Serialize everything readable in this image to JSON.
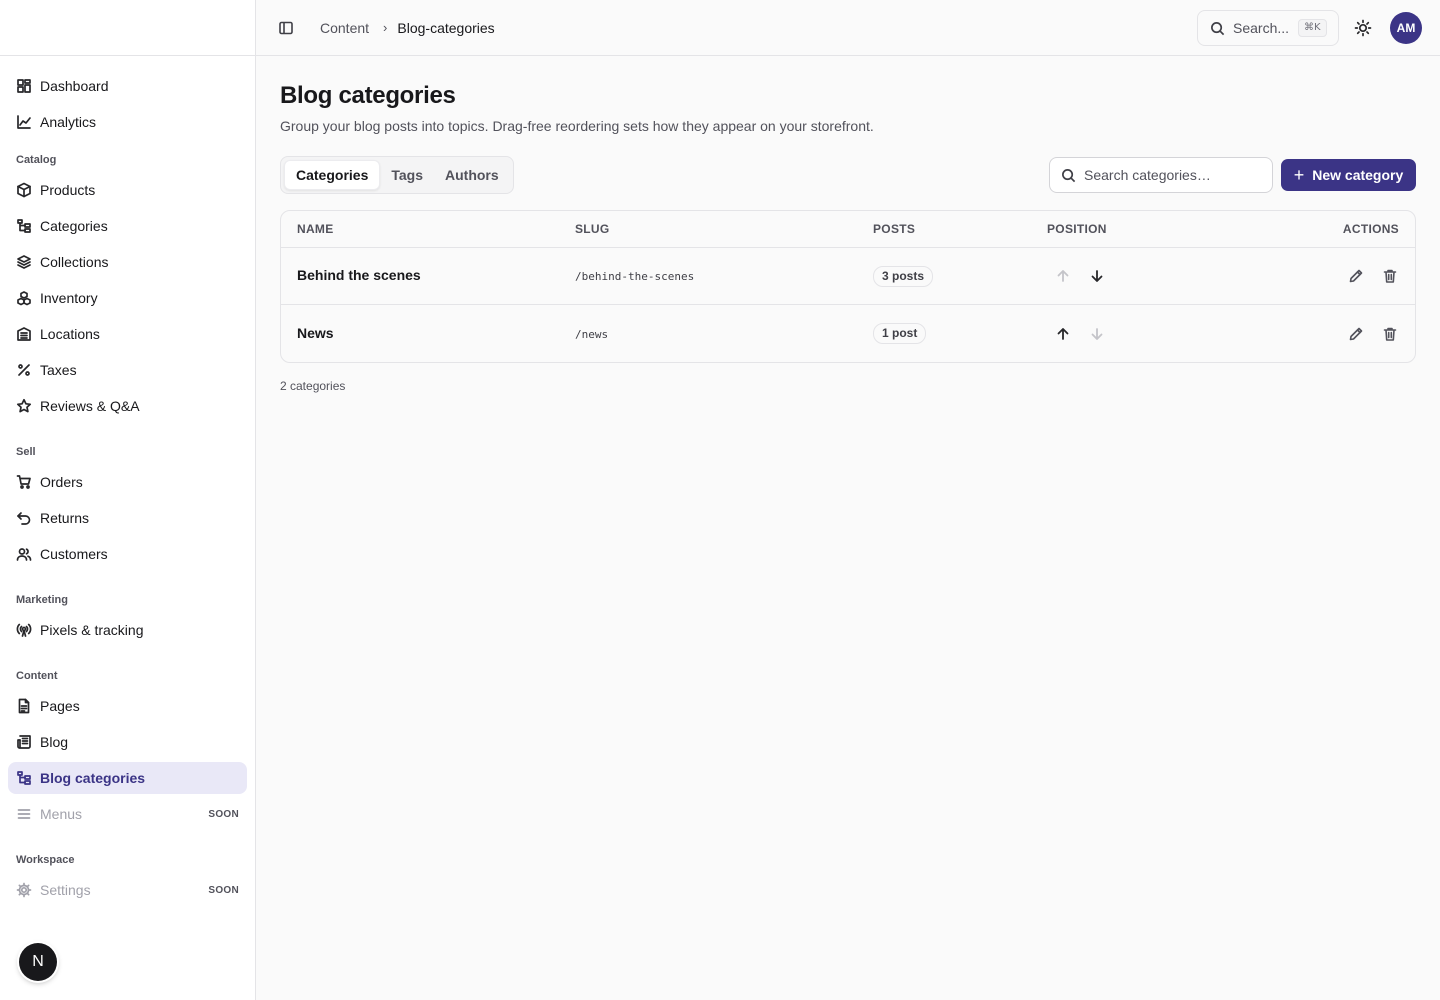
{
  "sidebar": {
    "primary": [
      {
        "label": "Dashboard",
        "icon": "dashboard-icon"
      },
      {
        "label": "Analytics",
        "icon": "analytics-icon"
      }
    ],
    "groups": [
      {
        "title": "Catalog",
        "items": [
          {
            "label": "Products",
            "icon": "box-icon"
          },
          {
            "label": "Categories",
            "icon": "tree-icon"
          },
          {
            "label": "Collections",
            "icon": "layers-icon"
          },
          {
            "label": "Inventory",
            "icon": "boxes-icon"
          },
          {
            "label": "Locations",
            "icon": "building-icon"
          },
          {
            "label": "Taxes",
            "icon": "percent-icon"
          },
          {
            "label": "Reviews & Q&A",
            "icon": "star-icon"
          }
        ]
      },
      {
        "title": "Sell",
        "items": [
          {
            "label": "Orders",
            "icon": "cart-icon"
          },
          {
            "label": "Returns",
            "icon": "undo-icon"
          },
          {
            "label": "Customers",
            "icon": "users-icon"
          }
        ]
      },
      {
        "title": "Marketing",
        "items": [
          {
            "label": "Pixels & tracking",
            "icon": "radio-icon"
          }
        ]
      },
      {
        "title": "Content",
        "items": [
          {
            "label": "Pages",
            "icon": "file-icon"
          },
          {
            "label": "Blog",
            "icon": "newspaper-icon"
          },
          {
            "label": "Blog categories",
            "icon": "tree-icon",
            "active": true
          },
          {
            "label": "Menus",
            "icon": "menu-icon",
            "badge": "SOON"
          }
        ]
      },
      {
        "title": "Workspace",
        "items": [
          {
            "label": "Settings",
            "icon": "gear-icon",
            "badge": "SOON"
          }
        ]
      }
    ],
    "fab_label": "N"
  },
  "topbar": {
    "breadcrumb": [
      "Content",
      "Blog-categories"
    ],
    "breadcrumb_separator": "›",
    "search_placeholder": "Search...",
    "search_shortcut": "⌘K",
    "avatar_initials": "AM"
  },
  "page": {
    "title": "Blog categories",
    "subtitle": "Group your blog posts into topics. Drag-free reordering sets how they appear on your storefront.",
    "tabs": [
      "Categories",
      "Tags",
      "Authors"
    ],
    "active_tab": "Categories",
    "search_placeholder": "Search categories…",
    "new_button": "New category",
    "new_button_icon": "plus-icon",
    "footer_count": "2 categories"
  },
  "table": {
    "columns": [
      "NAME",
      "SLUG",
      "POSTS",
      "POSITION",
      "ACTIONS"
    ],
    "rows": [
      {
        "name": "Behind the scenes",
        "slug": "/behind-the-scenes",
        "posts": "3 posts",
        "up_enabled": false,
        "down_enabled": true
      },
      {
        "name": "News",
        "slug": "/news",
        "posts": "1 post",
        "up_enabled": true,
        "down_enabled": false
      }
    ]
  },
  "colors": {
    "accent": "#3b3486",
    "active_nav_bg": "#e9e8f7",
    "border": "#e4e4e7",
    "muted_text": "#52525b"
  }
}
